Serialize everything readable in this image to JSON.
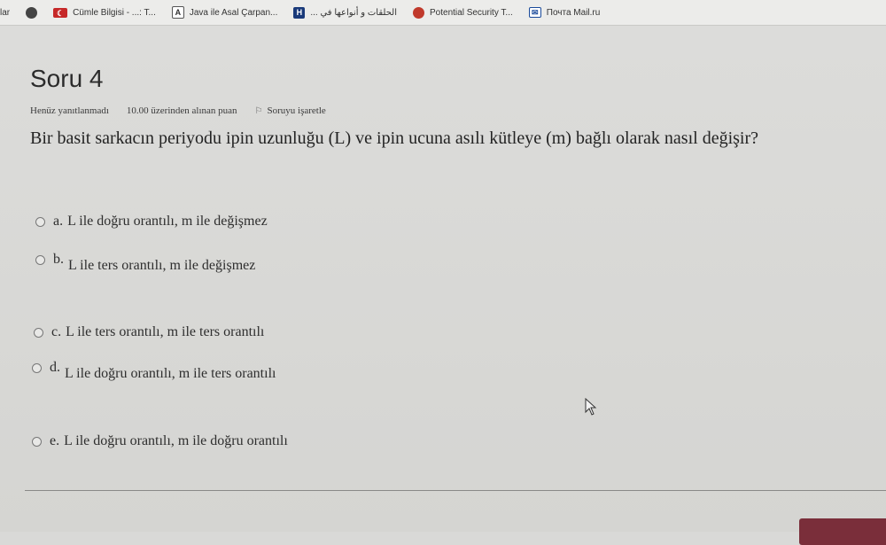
{
  "bookmarks": [
    {
      "label": "lar",
      "icon": "none"
    },
    {
      "label": "",
      "icon": "globe-icon"
    },
    {
      "label": "Cümle Bilgisi - ...: T...",
      "icon": "turkey-flag-icon"
    },
    {
      "label": "Java ile Asal Çarpan...",
      "icon": "document-icon"
    },
    {
      "label": "الحلقات و أنواعها في ...",
      "icon": "h-icon"
    },
    {
      "label": "Potential Security T...",
      "icon": "red-circle-icon"
    },
    {
      "label": "Почта Mail.ru",
      "icon": "mail-icon"
    }
  ],
  "question": {
    "title": "Soru 4",
    "status": "Henüz yanıtlanmadı",
    "points": "10.00 üzerinden alınan puan",
    "flag_label": "Soruyu işaretle",
    "text": "Bir basit sarkacın periyodu ipin uzunluğu (L) ve ipin ucuna asılı kütleye (m) bağlı olarak nasıl değişir?"
  },
  "answers": [
    {
      "letter": "a.",
      "text": "L ile doğru orantılı, m ile değişmez"
    },
    {
      "letter": "b.",
      "text": "L ile ters orantılı, m ile değişmez"
    },
    {
      "letter": "c.",
      "text": "L ile ters orantılı, m ile ters orantılı"
    },
    {
      "letter": "d.",
      "text": "L ile doğru orantılı, m ile ters orantılı"
    },
    {
      "letter": "e.",
      "text": "L ile doğru orantılı, m ile doğru orantılı"
    }
  ],
  "colors": {
    "accent": "#7a2e3a"
  }
}
